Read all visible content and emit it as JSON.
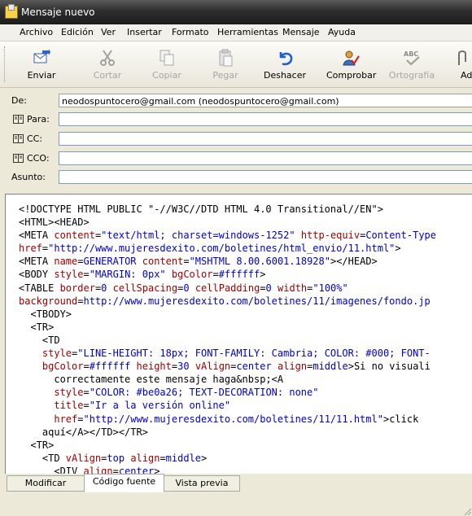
{
  "window": {
    "title": "Mensaje nuevo"
  },
  "menu": [
    "Archivo",
    "Edición",
    "Ver",
    "Insertar",
    "Formato",
    "Herramientas",
    "Mensaje",
    "Ayuda"
  ],
  "toolbar": {
    "enviar": "Enviar",
    "cortar": "Cortar",
    "copiar": "Copiar",
    "pegar": "Pegar",
    "deshacer": "Deshacer",
    "comprobar": "Comprobar",
    "ortografia": "Ortografía",
    "adjuntar": "Adj"
  },
  "fields": {
    "de_label": "De:",
    "de_value": "neodospuntocero@gmail.com     (neodospuntocero@gmail.com)",
    "para_label": "Para:",
    "cc_label": "CC:",
    "cco_label": "CCO:",
    "asunto_label": "Asunto:"
  },
  "source_lines": [
    [
      [
        "t",
        "<!DOCTYPE HTML PUBLIC \"-//W3C//DTD HTML 4.0 Transitional//EN\">"
      ]
    ],
    [
      [
        "t",
        "<HTML><HEAD>"
      ]
    ],
    [
      [
        "t",
        "<META "
      ],
      [
        "k",
        "content"
      ],
      [
        "t",
        "="
      ],
      [
        "v",
        "\"text/html; charset=windows-1252\""
      ],
      [
        "t",
        " "
      ],
      [
        "k",
        "http-equiv"
      ],
      [
        "t",
        "="
      ],
      [
        "v",
        "Content-Type"
      ]
    ],
    [
      [
        "k",
        "href"
      ],
      [
        "t",
        "="
      ],
      [
        "v",
        "\"http://www.mujeresdexito.com/boletines/html_envio/11.html\""
      ],
      [
        "t",
        ">"
      ]
    ],
    [
      [
        "t",
        "<META "
      ],
      [
        "k",
        "name"
      ],
      [
        "t",
        "="
      ],
      [
        "v",
        "GENERATOR"
      ],
      [
        "t",
        " "
      ],
      [
        "k",
        "content"
      ],
      [
        "t",
        "="
      ],
      [
        "v",
        "\"MSHTML 8.00.6001.18928\""
      ],
      [
        "t",
        "></HEAD>"
      ]
    ],
    [
      [
        "t",
        "<BODY "
      ],
      [
        "k",
        "style"
      ],
      [
        "t",
        "="
      ],
      [
        "v",
        "\"MARGIN: 0px\""
      ],
      [
        "t",
        " "
      ],
      [
        "k",
        "bgColor"
      ],
      [
        "t",
        "="
      ],
      [
        "v",
        "#ffffff"
      ],
      [
        "t",
        ">"
      ]
    ],
    [
      [
        "t",
        "<TABLE "
      ],
      [
        "k",
        "border"
      ],
      [
        "t",
        "="
      ],
      [
        "v",
        "0"
      ],
      [
        "t",
        " "
      ],
      [
        "k",
        "cellSpacing"
      ],
      [
        "t",
        "="
      ],
      [
        "v",
        "0"
      ],
      [
        "t",
        " "
      ],
      [
        "k",
        "cellPadding"
      ],
      [
        "t",
        "="
      ],
      [
        "v",
        "0"
      ],
      [
        "t",
        " "
      ],
      [
        "k",
        "width"
      ],
      [
        "t",
        "="
      ],
      [
        "v",
        "\"100%\""
      ]
    ],
    [
      [
        "k",
        "background"
      ],
      [
        "t",
        "="
      ],
      [
        "v",
        "http://www.mujeresdexito.com/boletines/11/imagenes/fondo.jp"
      ]
    ],
    [
      [
        "t",
        "  <TBODY>"
      ]
    ],
    [
      [
        "t",
        "  <TR>"
      ]
    ],
    [
      [
        "t",
        "    <TD"
      ]
    ],
    [
      [
        "t",
        "    "
      ],
      [
        "k",
        "style"
      ],
      [
        "t",
        "="
      ],
      [
        "v",
        "\"LINE-HEIGHT: 18px; FONT-FAMILY: Cambria; COLOR: #000; FONT-"
      ]
    ],
    [
      [
        "t",
        "    "
      ],
      [
        "k",
        "bgColor"
      ],
      [
        "t",
        "="
      ],
      [
        "v",
        "#ffffff"
      ],
      [
        "t",
        " "
      ],
      [
        "k",
        "height"
      ],
      [
        "t",
        "="
      ],
      [
        "v",
        "30"
      ],
      [
        "t",
        " "
      ],
      [
        "k",
        "vAlign"
      ],
      [
        "t",
        "="
      ],
      [
        "v",
        "center"
      ],
      [
        "t",
        " "
      ],
      [
        "k",
        "align"
      ],
      [
        "t",
        "="
      ],
      [
        "v",
        "middle"
      ],
      [
        "t",
        ">Si no visuali"
      ]
    ],
    [
      [
        "t",
        "      correctamente este mensaje haga&nbsp;<A"
      ]
    ],
    [
      [
        "t",
        "      "
      ],
      [
        "k",
        "style"
      ],
      [
        "t",
        "="
      ],
      [
        "v",
        "\"COLOR: #be0a26; TEXT-DECORATION: none\""
      ]
    ],
    [
      [
        "t",
        "      "
      ],
      [
        "k",
        "title"
      ],
      [
        "t",
        "="
      ],
      [
        "v",
        "\"Ir a la versión online\""
      ]
    ],
    [
      [
        "t",
        "      "
      ],
      [
        "k",
        "href"
      ],
      [
        "t",
        "="
      ],
      [
        "v",
        "\"http://www.mujeresdexito.com/boletines/11/11.html\""
      ],
      [
        "t",
        ">click"
      ]
    ],
    [
      [
        "t",
        "    aquí</A></TD></TR>"
      ]
    ],
    [
      [
        "t",
        "  <TR>"
      ]
    ],
    [
      [
        "t",
        "    <TD "
      ],
      [
        "k",
        "vAlign"
      ],
      [
        "t",
        "="
      ],
      [
        "v",
        "top"
      ],
      [
        "t",
        " "
      ],
      [
        "k",
        "align"
      ],
      [
        "t",
        "="
      ],
      [
        "v",
        "middle"
      ],
      [
        "t",
        ">"
      ]
    ],
    [
      [
        "t",
        "      <DIV "
      ],
      [
        "k",
        "align"
      ],
      [
        "t",
        "="
      ],
      [
        "v",
        "center"
      ],
      [
        "t",
        ">"
      ]
    ]
  ],
  "tabs": [
    "Modificar",
    "Código fuente",
    "Vista previa"
  ],
  "active_tab": "Código fuente",
  "colors": {
    "tag": "#000000",
    "attribute": "#a00000",
    "value": "#0000c8",
    "titlebar": "#2e2e2e",
    "chrome": "#ece9d8"
  }
}
